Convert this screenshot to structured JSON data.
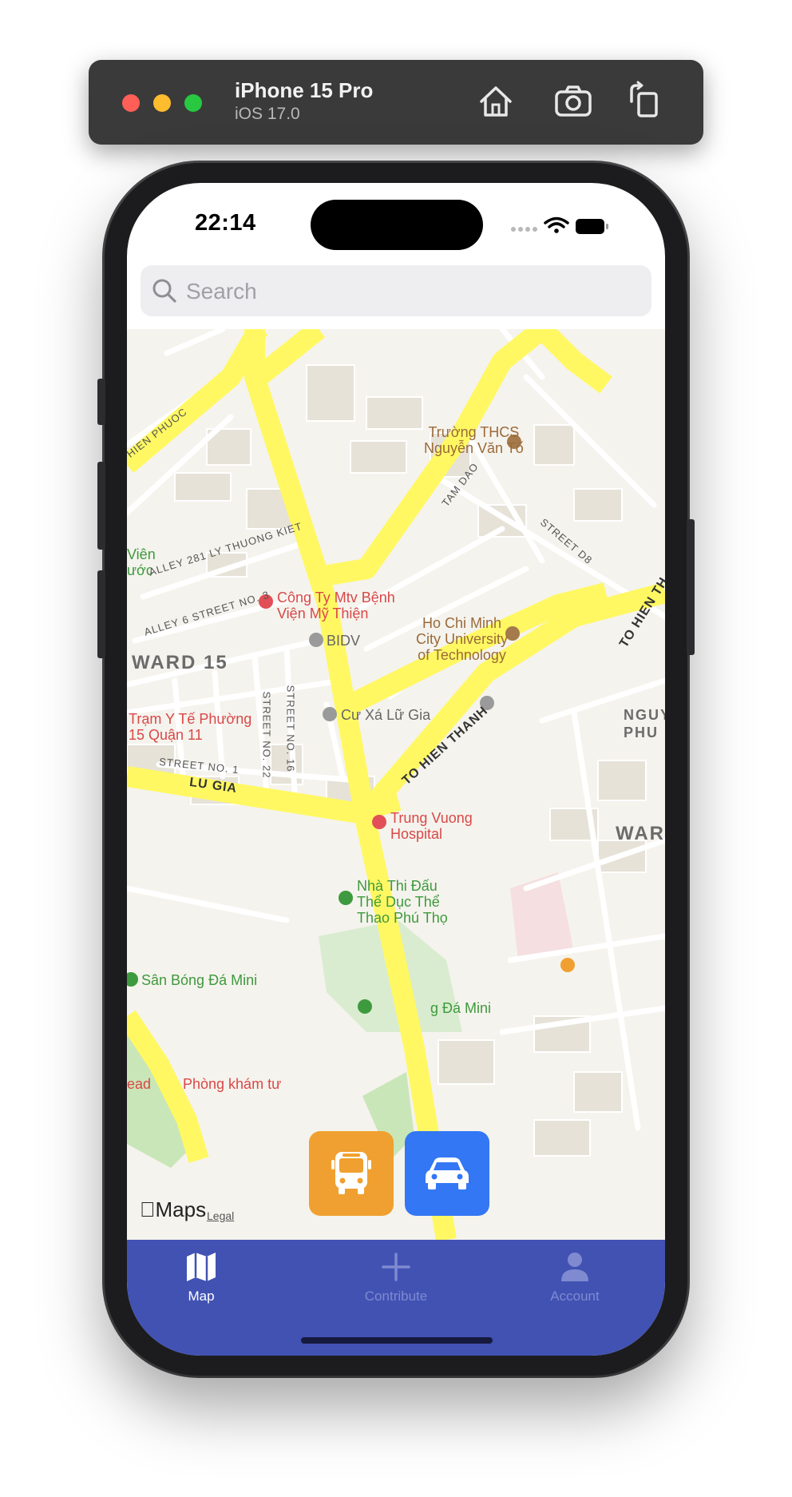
{
  "simulator": {
    "device": "iPhone 15 Pro",
    "os": "iOS 17.0",
    "buttons": [
      "home-icon",
      "screenshot-icon",
      "rotate-icon"
    ]
  },
  "status_bar": {
    "time": "22:14"
  },
  "search": {
    "placeholder": "Search",
    "value": ""
  },
  "map": {
    "poi_labels": {
      "school1_l1": "Trường THCS",
      "school1_l2": "Nguyễn Văn Tố",
      "hospital1_l1": "Công Ty Mtv Bệnh",
      "hospital1_l2": "Viện Mỹ Thiện",
      "bank": "BIDV",
      "university_l1": "Ho Chi Minh",
      "university_l2": "City University",
      "university_l3": "of Technology",
      "health_station_l1": "Trạm Y Tế Phường",
      "health_station_l2": "15 Quận 11",
      "residence": "Cư Xá Lữ Gia",
      "hospital2_l1": "Trung Vuong",
      "hospital2_l2": "Hospital",
      "stadium_l1": "Nhà Thi Đấu",
      "stadium_l2": "Thể Dục Thể",
      "stadium_l3": "Thao Phú Thọ",
      "field1": "Sân Bóng Đá Mini",
      "field2": "g Đá Mini",
      "clinic": "Phòng khám tư",
      "clinic_prefix": "ead",
      "park_l1": "Viên",
      "park_l2": "ước"
    },
    "area_labels": {
      "ward15": "WARD 15",
      "ward_right": "WARD",
      "nguyen_l1": "NGUY",
      "nguyen_l2": "PHU"
    },
    "street_labels": {
      "hien_phuoc": "HIEN PHUOC",
      "alley281": "ALLEY 281 LY THUONG KIET",
      "alley6": "ALLEY 6 STREET NO. 3",
      "tam_dao": "TAM DAO",
      "street_d8": "STREET D8",
      "street22": "STREET NO. 22",
      "street16": "STREET NO. 16",
      "street1": "STREET NO. 1",
      "lu_gia": "LU GIA",
      "to_hien_thanh": "TO HIEN THANH",
      "to_hien_th": "TO HIEN TH"
    },
    "attribution": {
      "logo": "Maps",
      "legal": "Legal"
    }
  },
  "fab": {
    "bus_icon": "bus-icon",
    "car_icon": "car-icon",
    "bus_color": "#f0a030",
    "car_color": "#3377f5"
  },
  "tabbar": {
    "background": "#4152b3",
    "tabs": [
      {
        "label": "Map",
        "icon": "map-icon",
        "active": true
      },
      {
        "label": "Contribute",
        "icon": "plus-icon",
        "active": false
      },
      {
        "label": "Account",
        "icon": "person-icon",
        "active": false
      }
    ]
  }
}
